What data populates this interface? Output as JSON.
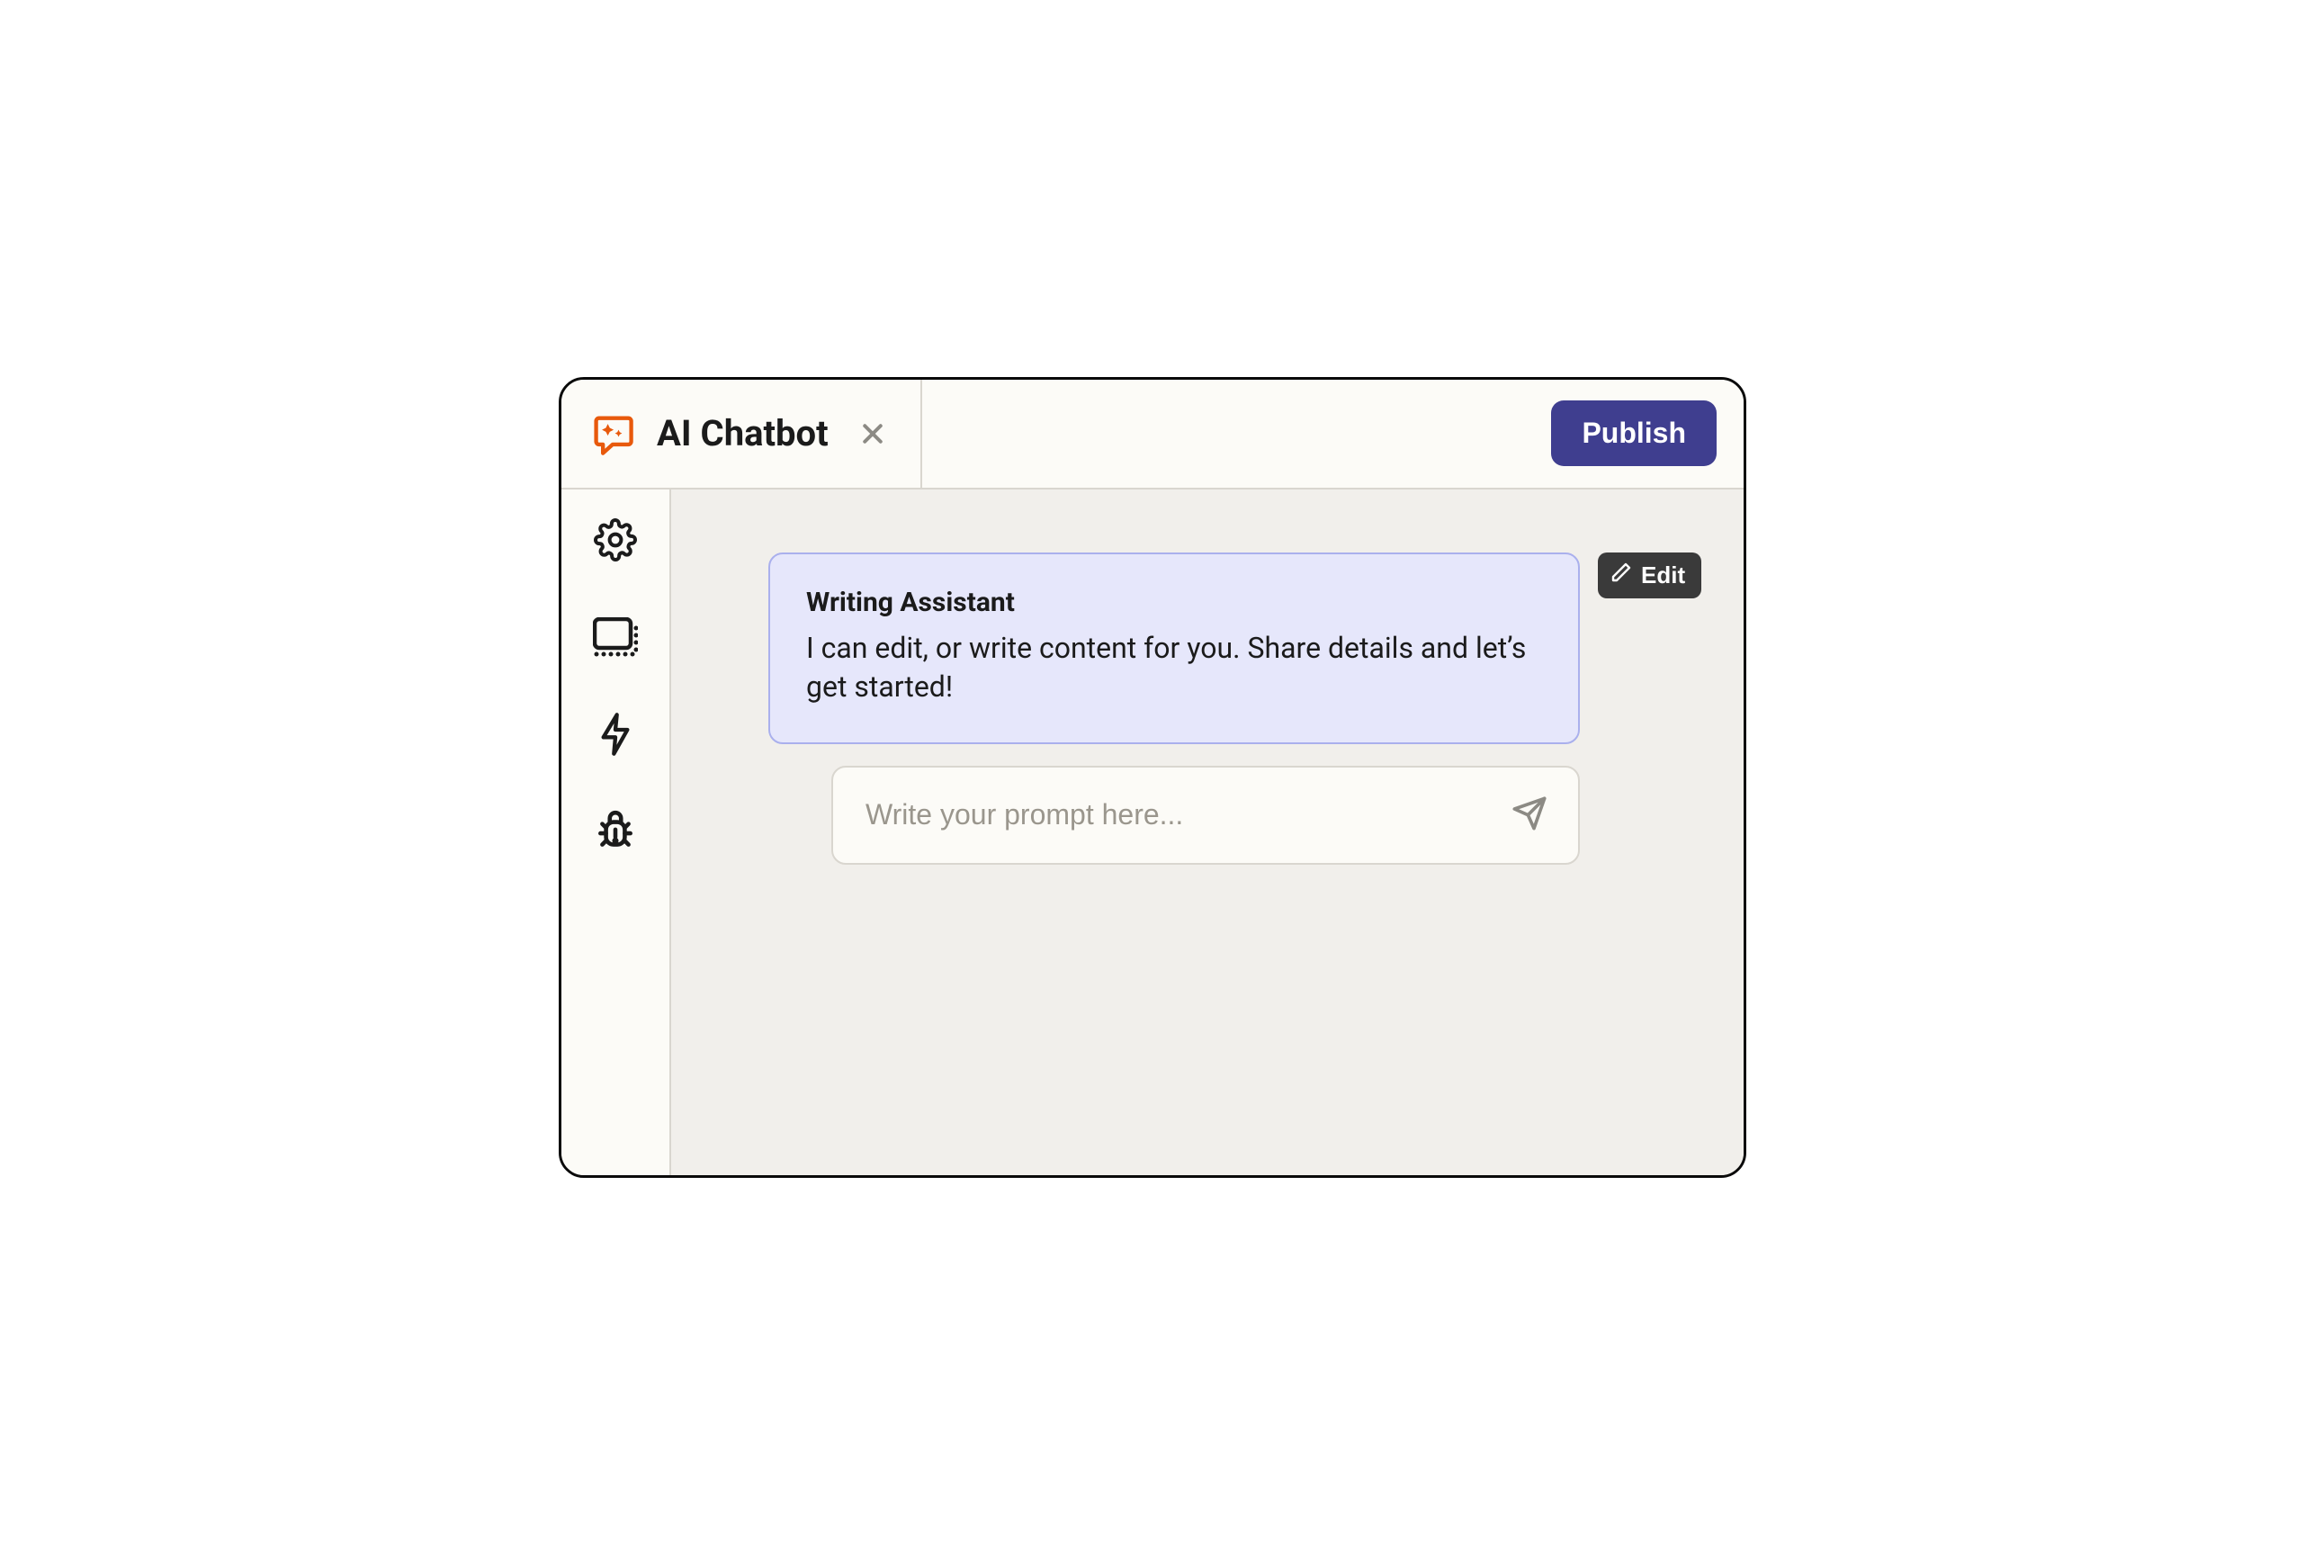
{
  "header": {
    "title": "AI Chatbot",
    "publish_label": "Publish"
  },
  "sidebar": {
    "items": [
      {
        "name": "settings"
      },
      {
        "name": "placeholder"
      },
      {
        "name": "action"
      },
      {
        "name": "debug"
      }
    ]
  },
  "main": {
    "card": {
      "title": "Writing Assistant",
      "body": "I can edit, or write content for you. Share details and let’s get started!"
    },
    "edit_label": "Edit",
    "prompt": {
      "placeholder": "Write your prompt here...",
      "value": ""
    }
  }
}
